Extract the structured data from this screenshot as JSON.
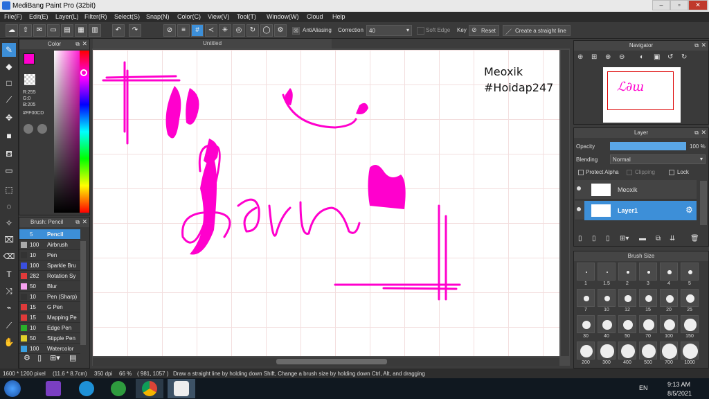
{
  "window": {
    "title": "MediBang Paint Pro (32bit)"
  },
  "menu": [
    "File(F)",
    "Edit(E)",
    "Layer(L)",
    "Filter(R)",
    "Select(S)",
    "Snap(N)",
    "Color(C)",
    "View(V)",
    "Tool(T)",
    "Window(W)",
    "Cloud",
    "Help"
  ],
  "toolbar": {
    "antialiasing": "AntiAliasing",
    "correction_label": "Correction",
    "correction_value": "40",
    "soft_edge": "Soft Edge",
    "key": "Key",
    "reset": "Reset",
    "straight_line": "Create a straight line"
  },
  "color_panel": {
    "title": "Color",
    "r": "R:255",
    "g": "G:0",
    "b": "B:205",
    "hex": "#FF00CD"
  },
  "brush_panel": {
    "title": "Brush: Pencil",
    "items": [
      {
        "size": "5",
        "name": "Pencil",
        "color": "#3d8fd8"
      },
      {
        "size": "100",
        "name": "Airbrush",
        "color": "#aaaaaa"
      },
      {
        "size": "10",
        "name": "Pen",
        "color": "#333333"
      },
      {
        "size": "100",
        "name": "Sparkle Bru",
        "color": "#3a4fe0"
      },
      {
        "size": "282",
        "name": "Rotation Sy",
        "color": "#e03a3a"
      },
      {
        "size": "50",
        "name": "Blur",
        "color": "#f7a1f0"
      },
      {
        "size": "10",
        "name": "Pen (Sharp)",
        "color": "#333333"
      },
      {
        "size": "15",
        "name": "G Pen",
        "color": "#e03a3a"
      },
      {
        "size": "15",
        "name": "Mapping Pe",
        "color": "#e03a3a"
      },
      {
        "size": "10",
        "name": "Edge Pen",
        "color": "#2ab02a"
      },
      {
        "size": "50",
        "name": "Stipple Pen",
        "color": "#e0d02a"
      },
      {
        "size": "100",
        "name": "Watercolor",
        "color": "#3aa0e0"
      }
    ]
  },
  "canvas": {
    "tab": "Untitled",
    "watermark_1": "Meoxik",
    "watermark_2": "#Hoidap247",
    "ink_color": "#FF00CD"
  },
  "navigator": {
    "title": "Navigator"
  },
  "layer_panel": {
    "title": "Layer",
    "opacity_label": "Opacity",
    "opacity_value": "100 %",
    "opacity_fraction": 1.0,
    "blending_label": "Blending",
    "blending_value": "Normal",
    "protect_alpha": "Protect Alpha",
    "clipping": "Clipping",
    "lock": "Lock",
    "layers": [
      {
        "name": "Meoxik"
      },
      {
        "name": "Layer1"
      }
    ]
  },
  "brush_size": {
    "title": "Brush Size",
    "sizes": [
      "1",
      "1.5",
      "2",
      "3",
      "4",
      "5",
      "7",
      "10",
      "12",
      "15",
      "20",
      "25",
      "30",
      "40",
      "50",
      "70",
      "100",
      "150",
      "200",
      "300",
      "400",
      "500",
      "700",
      "1000"
    ]
  },
  "status": {
    "pixel": "1600 * 1200 pixel",
    "cm": "(11.6 * 8.7cm)",
    "dpi": "350 dpi",
    "zoom": "66 %",
    "coords": "( 981, 1057 )",
    "hint": "Draw a straight line by holding down Shift, Change a brush size by holding down Ctrl, Alt, and dragging"
  },
  "taskbar": {
    "lang": "EN",
    "time": "9:13 AM",
    "date": "8/5/2021"
  }
}
